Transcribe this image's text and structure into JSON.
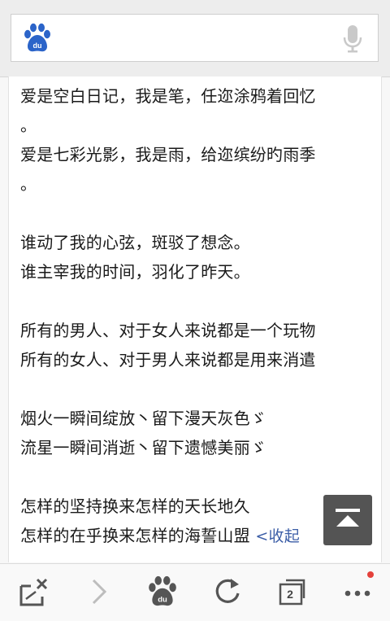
{
  "content": {
    "lines": [
      "爱是空白日记，我是笔，任迩涂鸦着回忆",
      "。",
      "爱是七彩光影，我是雨，给迩缤纷旳雨季",
      "。",
      "",
      "谁动了我的心弦，斑驳了想念。",
      "谁主宰我的时间，羽化了昨天。",
      "",
      "所有的男人、对于女人来说都是一个玩物",
      "所有的女人、对于男人来说都是用来消遣",
      "",
      "烟火一瞬间绽放丶留下漫天灰色ゞ",
      "流星一瞬间消逝丶留下遗憾美丽ゞ",
      "",
      "怎样的坚持换来怎样的天长地久",
      "怎样的在乎换来怎样的海誓山盟"
    ],
    "collapse_label": "<收起"
  },
  "bottom_nav": {
    "tab_count": "2"
  },
  "icons": {
    "search_logo": "baidu-paw-icon",
    "mic": "microphone-icon",
    "scroll_top": "scroll-to-top-icon",
    "close_page": "close-page-icon",
    "forward": "forward-arrow-icon",
    "home": "baidu-paw-icon",
    "refresh": "refresh-icon",
    "tabs": "tabs-icon",
    "menu": "more-menu-icon"
  },
  "colors": {
    "link": "#3c5ea7",
    "logo": "#2b64c9",
    "notification": "#e4413b"
  }
}
